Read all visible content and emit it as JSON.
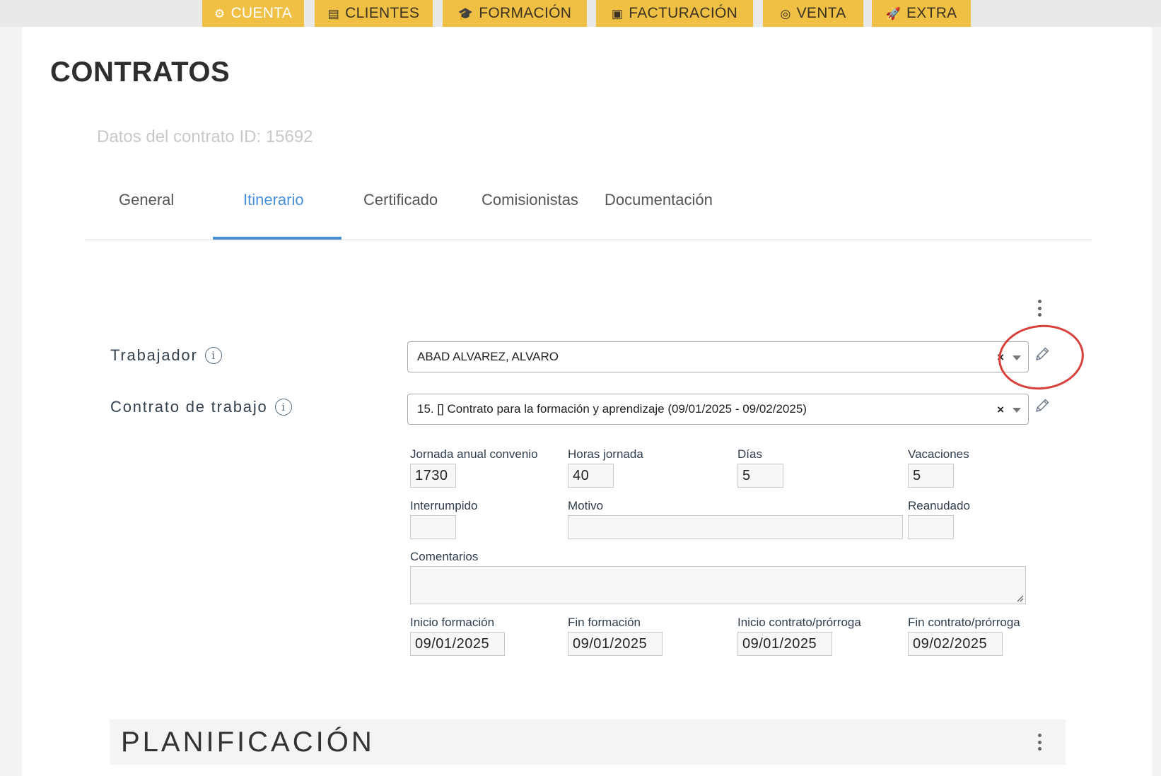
{
  "nav": {
    "tabs": [
      {
        "label": "CUENTA",
        "icon": "gears-icon"
      },
      {
        "label": "CLIENTES",
        "icon": "building-icon"
      },
      {
        "label": "FORMACIÓN",
        "icon": "graduation-cap-icon"
      },
      {
        "label": "FACTURACIÓN",
        "icon": "money-icon"
      },
      {
        "label": "VENTA",
        "icon": "target-icon"
      },
      {
        "label": "EXTRA",
        "icon": "rocket-icon"
      }
    ],
    "active": "CUENTA",
    "color": "#f0c044"
  },
  "page": {
    "title": "CONTRATOS",
    "subtitle": "Datos del contrato ID: 15692"
  },
  "tabs": {
    "items": [
      "General",
      "Itinerario",
      "Certificado",
      "Comisionistas",
      "Documentación"
    ],
    "active": "Itinerario",
    "accent": "#4a90d9"
  },
  "form": {
    "trabajador": {
      "label": "Trabajador",
      "value": "ABAD ALVAREZ, ALVARO"
    },
    "contrato": {
      "label": "Contrato de trabajo",
      "value": "15. [] Contrato para la formación y aprendizaje (09/01/2025 - 09/02/2025)"
    },
    "clear_symbol": "×",
    "fields": {
      "jornada": {
        "label": "Jornada anual convenio",
        "value": "1730"
      },
      "horas": {
        "label": "Horas jornada",
        "value": "40"
      },
      "dias": {
        "label": "Días",
        "value": "5"
      },
      "vacaciones": {
        "label": "Vacaciones",
        "value": "5"
      },
      "interrumpido": {
        "label": "Interrumpido",
        "value": ""
      },
      "motivo": {
        "label": "Motivo",
        "value": ""
      },
      "reanudado": {
        "label": "Reanudado",
        "value": ""
      },
      "comentarios": {
        "label": "Comentarios",
        "value": ""
      },
      "inicio_formacion": {
        "label": "Inicio formación",
        "value": "09/01/2025"
      },
      "fin_formacion": {
        "label": "Fin formación",
        "value": "09/01/2025"
      },
      "inicio_contrato": {
        "label": "Inicio contrato/prórroga",
        "value": "09/01/2025"
      },
      "fin_contrato": {
        "label": "Fin contrato/prórroga",
        "value": "09/02/2025"
      }
    }
  },
  "planificacion": {
    "title": "PLANIFICACIÓN"
  },
  "highlight_color": "#d9403c"
}
